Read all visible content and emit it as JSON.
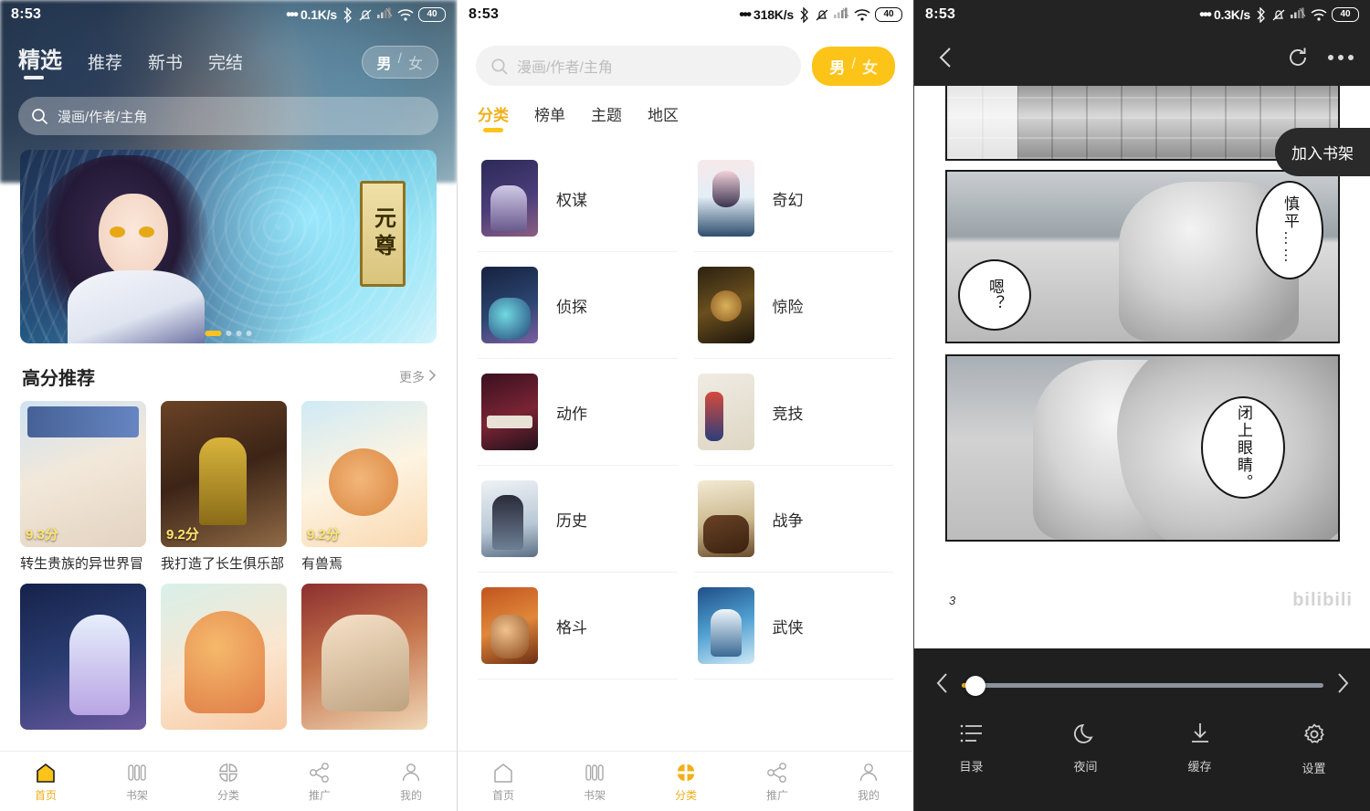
{
  "panel1": {
    "status": {
      "time": "8:53",
      "network_speed": "0.1K/s",
      "battery": "40",
      "icons": [
        "bluetooth-icon",
        "mute-bell-icon",
        "signal-icon",
        "wifi-icon",
        "battery-icon"
      ]
    },
    "tabs": [
      {
        "label": "精选",
        "active": true
      },
      {
        "label": "推荐",
        "active": false
      },
      {
        "label": "新书",
        "active": false
      },
      {
        "label": "完结",
        "active": false
      }
    ],
    "gender_toggle": {
      "male": "男",
      "separator": "/",
      "female": "女",
      "selected": "男"
    },
    "search": {
      "placeholder": "漫画/作者/主角",
      "icon": "search-icon"
    },
    "banner": {
      "title": "元尊",
      "slide_count": 4,
      "active_slide": 1
    },
    "section": {
      "title": "高分推荐",
      "more": "更多",
      "more_icon": "chevron-right-icon"
    },
    "books_row1": [
      {
        "title": "转生贵族的异世界冒",
        "score": "9.3分"
      },
      {
        "title": "我打造了长生俱乐部",
        "score": "9.2分"
      },
      {
        "title": "有兽焉",
        "score": "9.2分"
      }
    ],
    "books_row2": [
      {
        "title": "",
        "score": ""
      },
      {
        "title": "",
        "score": ""
      },
      {
        "title": "",
        "score": ""
      }
    ],
    "bottom_nav": [
      {
        "label": "首页",
        "icon": "home-icon",
        "active": true
      },
      {
        "label": "书架",
        "icon": "bookshelf-icon",
        "active": false
      },
      {
        "label": "分类",
        "icon": "category-grid-icon",
        "active": false
      },
      {
        "label": "推广",
        "icon": "share-icon",
        "active": false
      },
      {
        "label": "我的",
        "icon": "person-icon",
        "active": false
      }
    ]
  },
  "panel2": {
    "status": {
      "time": "8:53",
      "network_speed": "318K/s",
      "battery": "40"
    },
    "search": {
      "placeholder": "漫画/作者/主角",
      "icon": "search-icon"
    },
    "gender_toggle": {
      "male": "男",
      "separator": "/",
      "female": "女",
      "selected": "男"
    },
    "tabs": [
      {
        "label": "分类",
        "active": true
      },
      {
        "label": "榜单",
        "active": false
      },
      {
        "label": "主题",
        "active": false
      },
      {
        "label": "地区",
        "active": false
      }
    ],
    "categories": [
      {
        "label": "权谋"
      },
      {
        "label": "奇幻"
      },
      {
        "label": "侦探"
      },
      {
        "label": "惊险"
      },
      {
        "label": "动作"
      },
      {
        "label": "竞技"
      },
      {
        "label": "历史"
      },
      {
        "label": "战争"
      },
      {
        "label": "格斗"
      },
      {
        "label": "武侠"
      }
    ],
    "bottom_nav": [
      {
        "label": "首页",
        "icon": "home-icon",
        "active": false
      },
      {
        "label": "书架",
        "icon": "bookshelf-icon",
        "active": false
      },
      {
        "label": "分类",
        "icon": "category-grid-icon",
        "active": true
      },
      {
        "label": "推广",
        "icon": "share-icon",
        "active": false
      },
      {
        "label": "我的",
        "icon": "person-icon",
        "active": false
      }
    ]
  },
  "panel3": {
    "status": {
      "time": "8:53",
      "network_speed": "0.3K/s",
      "battery": "40"
    },
    "topbar": {
      "back_icon": "back-chevron-icon",
      "refresh_icon": "refresh-icon",
      "more_icon": "more-dots-icon"
    },
    "add_shelf_button": "加入书架",
    "bubbles": {
      "top_right": "慎平……",
      "mid_left": "嗯？",
      "bottom": "闭上眼睛。"
    },
    "page_number": "3",
    "watermark": "bilibili",
    "seek": {
      "progress_percent": 3,
      "prev_icon": "chevron-left-icon",
      "next_icon": "chevron-right-icon"
    },
    "tools": [
      {
        "label": "目录",
        "icon": "list-icon"
      },
      {
        "label": "夜间",
        "icon": "moon-icon"
      },
      {
        "label": "缓存",
        "icon": "download-icon"
      },
      {
        "label": "设置",
        "icon": "gear-icon"
      }
    ]
  },
  "colors": {
    "accent_yellow": "#fcc319",
    "accent_dark_yellow": "#f0b018",
    "nav_inactive": "#9b9b9b",
    "reader_bar": "#1f1f1f"
  }
}
